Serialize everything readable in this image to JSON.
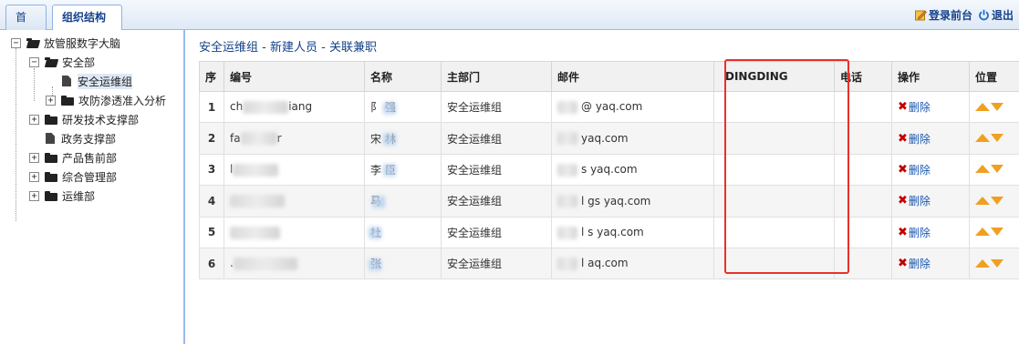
{
  "tabs": [
    {
      "label": "首页"
    },
    {
      "label": "组织结构",
      "close": "×"
    }
  ],
  "top_actions": {
    "login_front": "登录前台",
    "logout": "退出"
  },
  "tree": {
    "root": "放管服数字大脑",
    "security_dept": "安全部",
    "ops_group": "安全运维组",
    "attack_group": "攻防渗透准入分析",
    "rnd": "研发技术支撑部",
    "gov_support": "政务支撑部",
    "presales": "产品售前部",
    "general_mgmt": "综合管理部",
    "ops_dept": "运维部"
  },
  "breadcrumb": {
    "group": "安全运维组",
    "sep1": " - ",
    "new_member": "新建人员",
    "sep2": " - ",
    "link_part_time": "关联兼职"
  },
  "table": {
    "headers": {
      "seq": "序",
      "id": "编号",
      "name": "名称",
      "dept": "主部门",
      "email": "邮件",
      "dingding": "DINGDING",
      "phone": "电话",
      "ops": "操作",
      "position": "位置"
    },
    "rows": [
      {
        "seq": "1",
        "id_prefix": "ch",
        "id_suffix": "iang",
        "email_suffix": "@      yaq.com",
        "dept": "安全运维组",
        "delete": "删除"
      },
      {
        "seq": "2",
        "id_prefix": "fa",
        "id_suffix": "r",
        "email_suffix": "yaq.com",
        "dept": "安全运维组",
        "delete": "删除"
      },
      {
        "seq": "3",
        "id_prefix": "l",
        "id_suffix": "",
        "email_suffix": "s      yaq.com",
        "dept": "安全运维组",
        "delete": "删除"
      },
      {
        "seq": "4",
        "id_prefix": "",
        "id_suffix": "",
        "email_suffix": "l      gs      yaq.com",
        "dept": "安全运维组",
        "delete": "删除"
      },
      {
        "seq": "5",
        "id_prefix": "",
        "id_suffix": "",
        "email_suffix": "l      s      yaq.com",
        "dept": "安全运维组",
        "delete": "删除"
      },
      {
        "seq": "6",
        "id_prefix": ".",
        "id_suffix": "",
        "email_suffix": "l      aq.com",
        "dept": "安全运维组",
        "delete": "删除"
      }
    ],
    "name_fragments": [
      "阝 强",
      "宋 林",
      "李 臣",
      "马 ",
      "杜",
      "张"
    ]
  },
  "colors": {
    "accent": "#15428b",
    "highlight_border": "#e8302a",
    "delete_icon": "#c00000",
    "position_arrow": "#f0a020"
  }
}
